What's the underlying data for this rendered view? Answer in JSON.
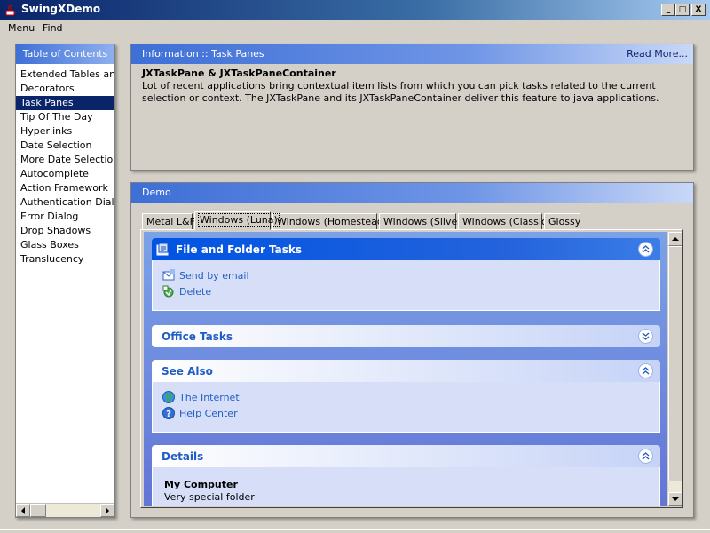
{
  "window": {
    "title": "SwingXDemo",
    "controls": {
      "minimize": "_",
      "maximize": "□",
      "close": "X"
    }
  },
  "menu": {
    "items": [
      "Menu",
      "Find"
    ]
  },
  "toc": {
    "header": "Table of Contents",
    "items": [
      "Extended Tables and",
      "Decorators",
      "Task Panes",
      "Tip Of The Day",
      "Hyperlinks",
      "Date Selection",
      "More Date Selection",
      "Autocomplete",
      "Action Framework",
      "Authentication Dialogs",
      "Error Dialog",
      "Drop Shadows",
      "Glass Boxes",
      "Translucency"
    ],
    "selected_index": 2
  },
  "info": {
    "header": "Information :: Task Panes",
    "read_more": "Read More...",
    "heading": "JXTaskPane & JXTaskPaneContainer",
    "text": "Lot of recent applications bring contextual item lists from which you can pick tasks related to the current selection or context. The JXTaskPane and its JXTaskPaneContainer deliver this feature to java applications."
  },
  "demo": {
    "header": "Demo",
    "tabs": [
      "Metal L&F",
      "Windows (Luna)",
      "Windows (Homestead)",
      "Windows (Silver)",
      "Windows (Classic)",
      "Glossy"
    ],
    "active_tab_index": 1,
    "groups": {
      "file_folder": {
        "title": "File and Folder Tasks",
        "tasks": [
          "Send by email",
          "Delete"
        ]
      },
      "office": {
        "title": "Office Tasks"
      },
      "see_also": {
        "title": "See Also",
        "tasks": [
          "The Internet",
          "Help Center"
        ]
      },
      "details": {
        "title": "Details",
        "item_title": "My Computer",
        "item_sub": "Very special folder"
      }
    }
  },
  "colors": {
    "selection": "#0a246a",
    "header_gradient_start": "#3d6fd6",
    "taskpane_link": "#215dc6"
  }
}
